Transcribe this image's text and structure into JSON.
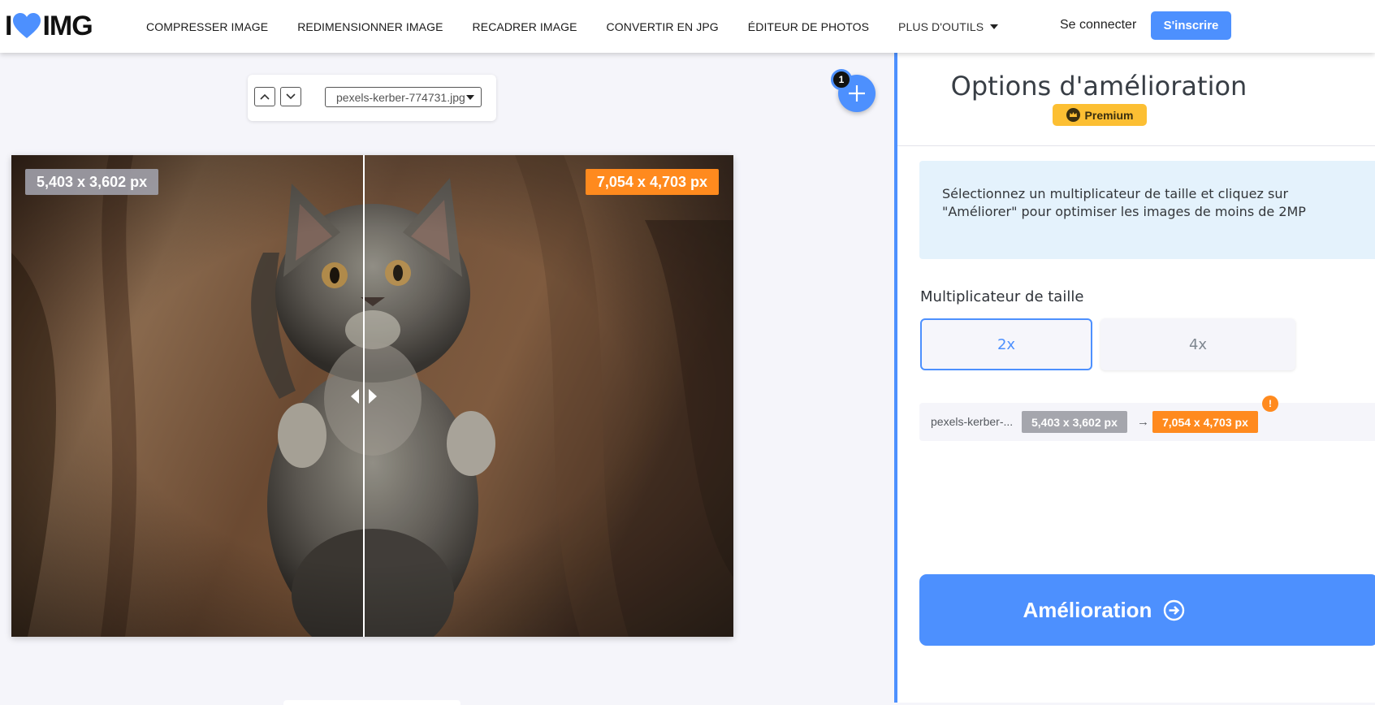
{
  "header": {
    "logo_left": "I",
    "logo_right": "IMG",
    "nav": [
      "COMPRESSER IMAGE",
      "REDIMENSIONNER IMAGE",
      "RECADRER IMAGE",
      "CONVERTIR EN JPG",
      "ÉDITEUR DE PHOTOS"
    ],
    "more_tools": "PLUS D'OUTILS",
    "login": "Se connecter",
    "signup": "S'inscrire"
  },
  "workspace": {
    "file_select": "pexels-kerber-774731.jpg",
    "file_count": "1",
    "original_size": "5,403 x 3,602 px",
    "enhanced_size": "7,054 x 4,703 px",
    "comparison_split": 0.488
  },
  "panel": {
    "title": "Options d'amélioration",
    "premium": "Premium",
    "info": "Sélectionnez un multiplicateur de taille et cliquez sur \"Améliorer\" pour optimiser les images de moins de 2MP",
    "multiplier_label": "Multiplicateur de taille",
    "multipliers": [
      "2x",
      "4x"
    ],
    "selected_multiplier": "2x",
    "file_row": {
      "name": "pexels-kerber-...",
      "from": "5,403 x 3,602 px",
      "arrow": "→",
      "to": "7,054 x 4,703 px",
      "warning": "!"
    },
    "process_button": "Amélioration"
  },
  "colors": {
    "accent": "#4d90fe",
    "orange": "#ff8a1e",
    "premium": "#fcbf33"
  }
}
